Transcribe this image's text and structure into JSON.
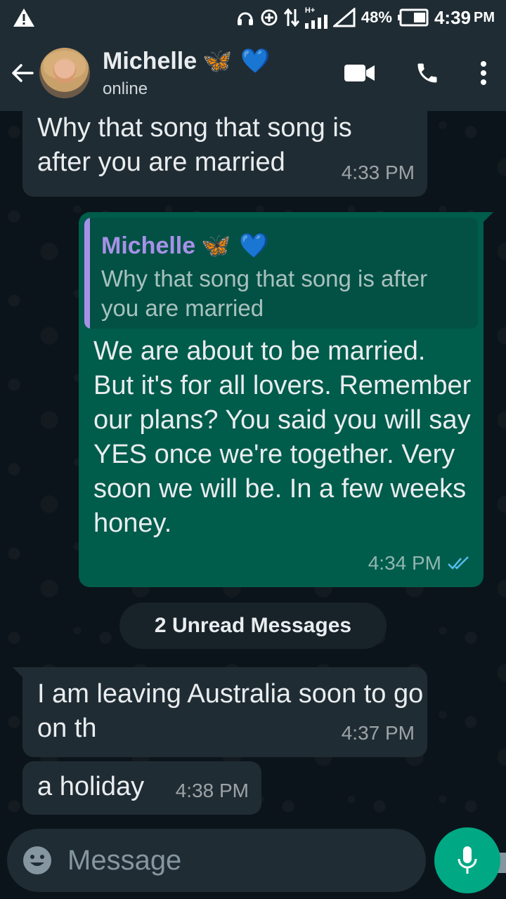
{
  "status_bar": {
    "battery_percent": "48%",
    "time": "4:39",
    "ampm": "PM",
    "network_label": "H+",
    "icons": [
      "warning-icon",
      "headset-icon",
      "data-saver-icon",
      "data-arrows-icon",
      "signal-icon",
      "signal-empty-icon",
      "battery-icon"
    ]
  },
  "header": {
    "contact_name": "Michelle",
    "name_emojis": "🦋 💙",
    "presence": "online",
    "icons": [
      "back-arrow-icon",
      "video-call-icon",
      "phone-icon",
      "more-vert-icon"
    ]
  },
  "messages": [
    {
      "id": "m1",
      "direction": "in",
      "text": "Why that song that song is after you are married",
      "time": "4:33 PM"
    },
    {
      "id": "m2",
      "direction": "out",
      "quote": {
        "name": "Michelle",
        "emojis": "🦋 💙",
        "text": "Why that song that song is after you are married"
      },
      "text": "We are about to be married. But it's for all lovers. Remember our plans?  You said you will say YES once we're together.  Very soon we will be.  In a few weeks honey.",
      "time": "4:34 PM",
      "read": true
    },
    {
      "id": "m3",
      "direction": "in",
      "text": "I am leaving Australia soon to go on th",
      "time": "4:37 PM"
    },
    {
      "id": "m4",
      "direction": "in",
      "text": "a holiday",
      "time": "4:38 PM"
    }
  ],
  "unread_banner": "2 Unread Messages",
  "composer": {
    "placeholder": "Message",
    "icons": [
      "emoji-icon",
      "attach-icon",
      "camera-icon",
      "mic-icon"
    ]
  },
  "colors": {
    "bar_bg": "#1f2c34",
    "chat_bg": "#0b141a",
    "incoming": "#202c33",
    "outgoing": "#005c4b",
    "accent": "#00a884",
    "quote_name": "#a791e8",
    "read_ticks": "#53bdeb"
  }
}
